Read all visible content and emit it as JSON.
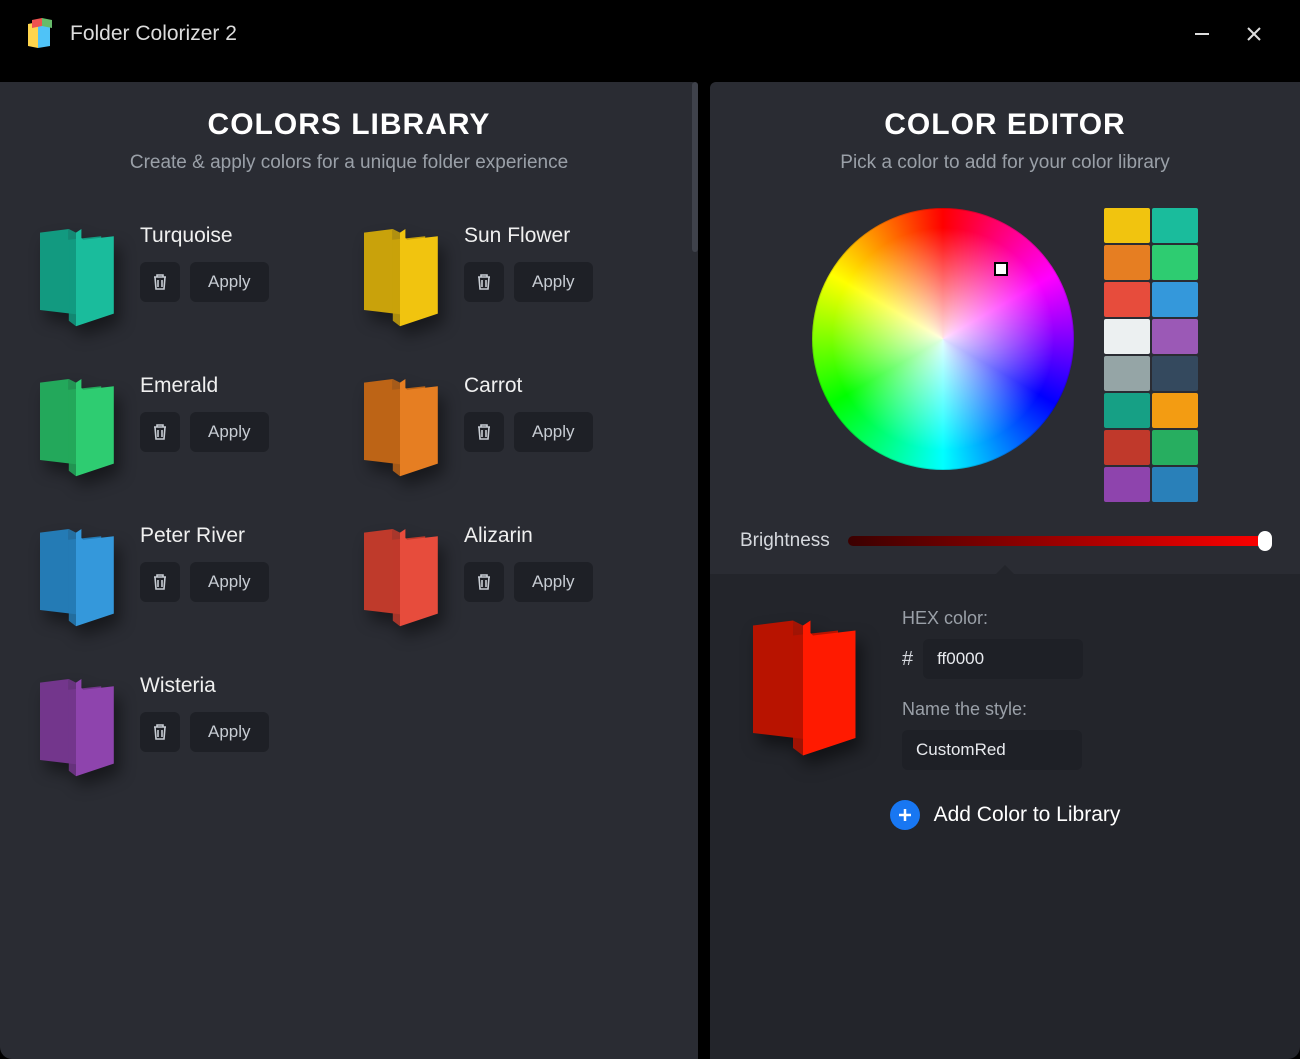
{
  "titlebar": {
    "app_title": "Folder Colorizer 2"
  },
  "library": {
    "heading": "Colors Library",
    "subheading": "Create & apply colors for a unique folder experience",
    "apply_label": "Apply",
    "items": [
      {
        "name": "Turquoise",
        "base": "#1abc9c",
        "shade": "#129a80"
      },
      {
        "name": "Sun Flower",
        "base": "#f1c40f",
        "shade": "#c9a20b"
      },
      {
        "name": "Emerald",
        "base": "#2ecc71",
        "shade": "#23a85b"
      },
      {
        "name": "Carrot",
        "base": "#e67e22",
        "shade": "#bd6416"
      },
      {
        "name": "Peter River",
        "base": "#3498db",
        "shade": "#247bb5"
      },
      {
        "name": "Alizarin",
        "base": "#e74c3c",
        "shade": "#bf3a2b"
      },
      {
        "name": "Wisteria",
        "base": "#8e44ad",
        "shade": "#73368c"
      }
    ]
  },
  "editor": {
    "heading": "Color Editor",
    "subheading": "Pick a color to add for your color library",
    "brightness_label": "Brightness",
    "swatches": [
      "#f1c40f",
      "#1abc9c",
      "#e67e22",
      "#2ecc71",
      "#e74c3c",
      "#3498db",
      "#ecf0f1",
      "#9b59b6",
      "#95a5a6",
      "#34495e",
      "#16a085",
      "#f39c12",
      "#c0392b",
      "#27ae60",
      "#8e44ad",
      "#2980b9"
    ],
    "hex_label": "HEX color:",
    "hex_prefix": "#",
    "hex_value": "ff0000",
    "name_label": "Name the style:",
    "name_value": "CustomRed",
    "add_label": "Add Color to Library",
    "preview": {
      "base": "#ff1a00",
      "shade": "#b81300"
    }
  }
}
